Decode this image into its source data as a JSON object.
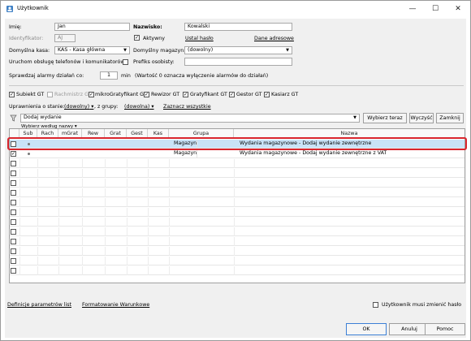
{
  "window": {
    "title": "Użytkownik",
    "minimize": "—",
    "maximize": "☐",
    "close": "✕"
  },
  "form": {
    "imie_label": "Imię:",
    "imie_value": "Jan",
    "nazwisko_label": "Nazwisko:",
    "nazwisko_value": "Kowalski",
    "identyfikator_label": "Identyfikator:",
    "identyfikator_value": "AJ",
    "aktywny_label": "Aktywny",
    "ustal_haslo": "Ustal hasło",
    "dane_adresowe": "Dane adresowe",
    "kasa_label": "Domyślna kasa:",
    "kasa_value": "KAS - Kasa główna",
    "magazyn_label": "Domyślny magazyn:",
    "magazyn_value": "(dowolny)",
    "uruchom_label": "Uruchom obsługę telefonów i komunikatorów",
    "prefiks_label": "Prefiks osobisty:",
    "alarm_label": "Sprawdzaj alarmy działań co:",
    "alarm_value": "1",
    "alarm_unit": "min",
    "alarm_note": "(Wartość 0 oznacza wyłączenie alarmów do działań)"
  },
  "roles": [
    {
      "label": "Subiekt GT",
      "checked": true,
      "disabled": false
    },
    {
      "label": "Rachmistrz GT",
      "checked": false,
      "disabled": true
    },
    {
      "label": "mikroGratyfikant GT",
      "checked": true,
      "disabled": false
    },
    {
      "label": "Rewizor GT",
      "checked": true,
      "disabled": false
    },
    {
      "label": "Gratyfikant GT",
      "checked": true,
      "disabled": false
    },
    {
      "label": "Gestor GT",
      "checked": true,
      "disabled": false
    },
    {
      "label": "Kasiarz GT",
      "checked": true,
      "disabled": false
    }
  ],
  "filters": {
    "state_label": "Uprawnienia o stanie:",
    "state_value": "(dowolny)",
    "group_label": ", z grupy:",
    "group_value": "(dowolna)",
    "select_all": "Zaznacz wszystkie"
  },
  "search": {
    "value": "Dodaj wydanie",
    "btn_choose": "Wybierz teraz",
    "btn_clear": "Wyczyść",
    "btn_close": "Zamknij",
    "sort_label": "Wybierz według nazwy"
  },
  "table": {
    "headers": [
      "Sub",
      "Rach",
      "mGrat",
      "Rew",
      "Grat",
      "Gest",
      "Kas",
      "Grupa",
      "Nazwa"
    ],
    "rows": [
      {
        "checked": false,
        "grupa": "Magazyn",
        "nazwa": "Wydania magazynowe - Dodaj wydanie zewnętrzne"
      },
      {
        "checked": true,
        "grupa": "Magazyn",
        "nazwa": "Wydania magazynowe - Dodaj wydanie zewnętrzne z VAT"
      }
    ]
  },
  "footer": {
    "def_params": "Definicje parametrów list",
    "format_cond": "Formatowanie Warunkowe",
    "must_change": "Użytkownik musi zmienić hasło",
    "ok": "OK",
    "cancel": "Anuluj",
    "help": "Pomoc"
  },
  "colors": {
    "highlight_row": "#c9e3f7",
    "highlight_border": "#d9262e"
  }
}
